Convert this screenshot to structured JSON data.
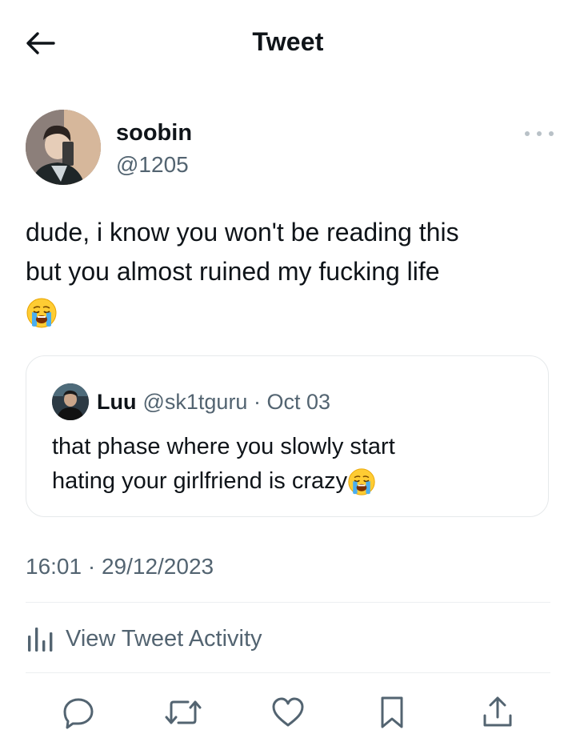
{
  "header": {
    "title": "Tweet",
    "back_icon": "arrow-left-icon"
  },
  "tweet": {
    "author_name": "soobin",
    "author_handle": "@1205",
    "text_line1": "dude, i know you won't be reading this",
    "text_line2": "but you almost ruined my fucking life",
    "emoji": "loudly-crying-face",
    "timestamp": "16:01 · 29/12/2023",
    "activity_label": "View Tweet Activity"
  },
  "quoted": {
    "name": "Luu",
    "meta": "@sk1tguru · Oct 03",
    "text_line1": "that phase where you slowly start",
    "text_line2": "hating your girlfriend is crazy",
    "emoji": "loudly-crying-face"
  },
  "actions": [
    "reply-icon",
    "retweet-icon",
    "like-icon",
    "bookmark-icon",
    "share-icon"
  ],
  "colors": {
    "text": "#0f1419",
    "secondary": "#536471",
    "border": "#e6e9eb"
  }
}
